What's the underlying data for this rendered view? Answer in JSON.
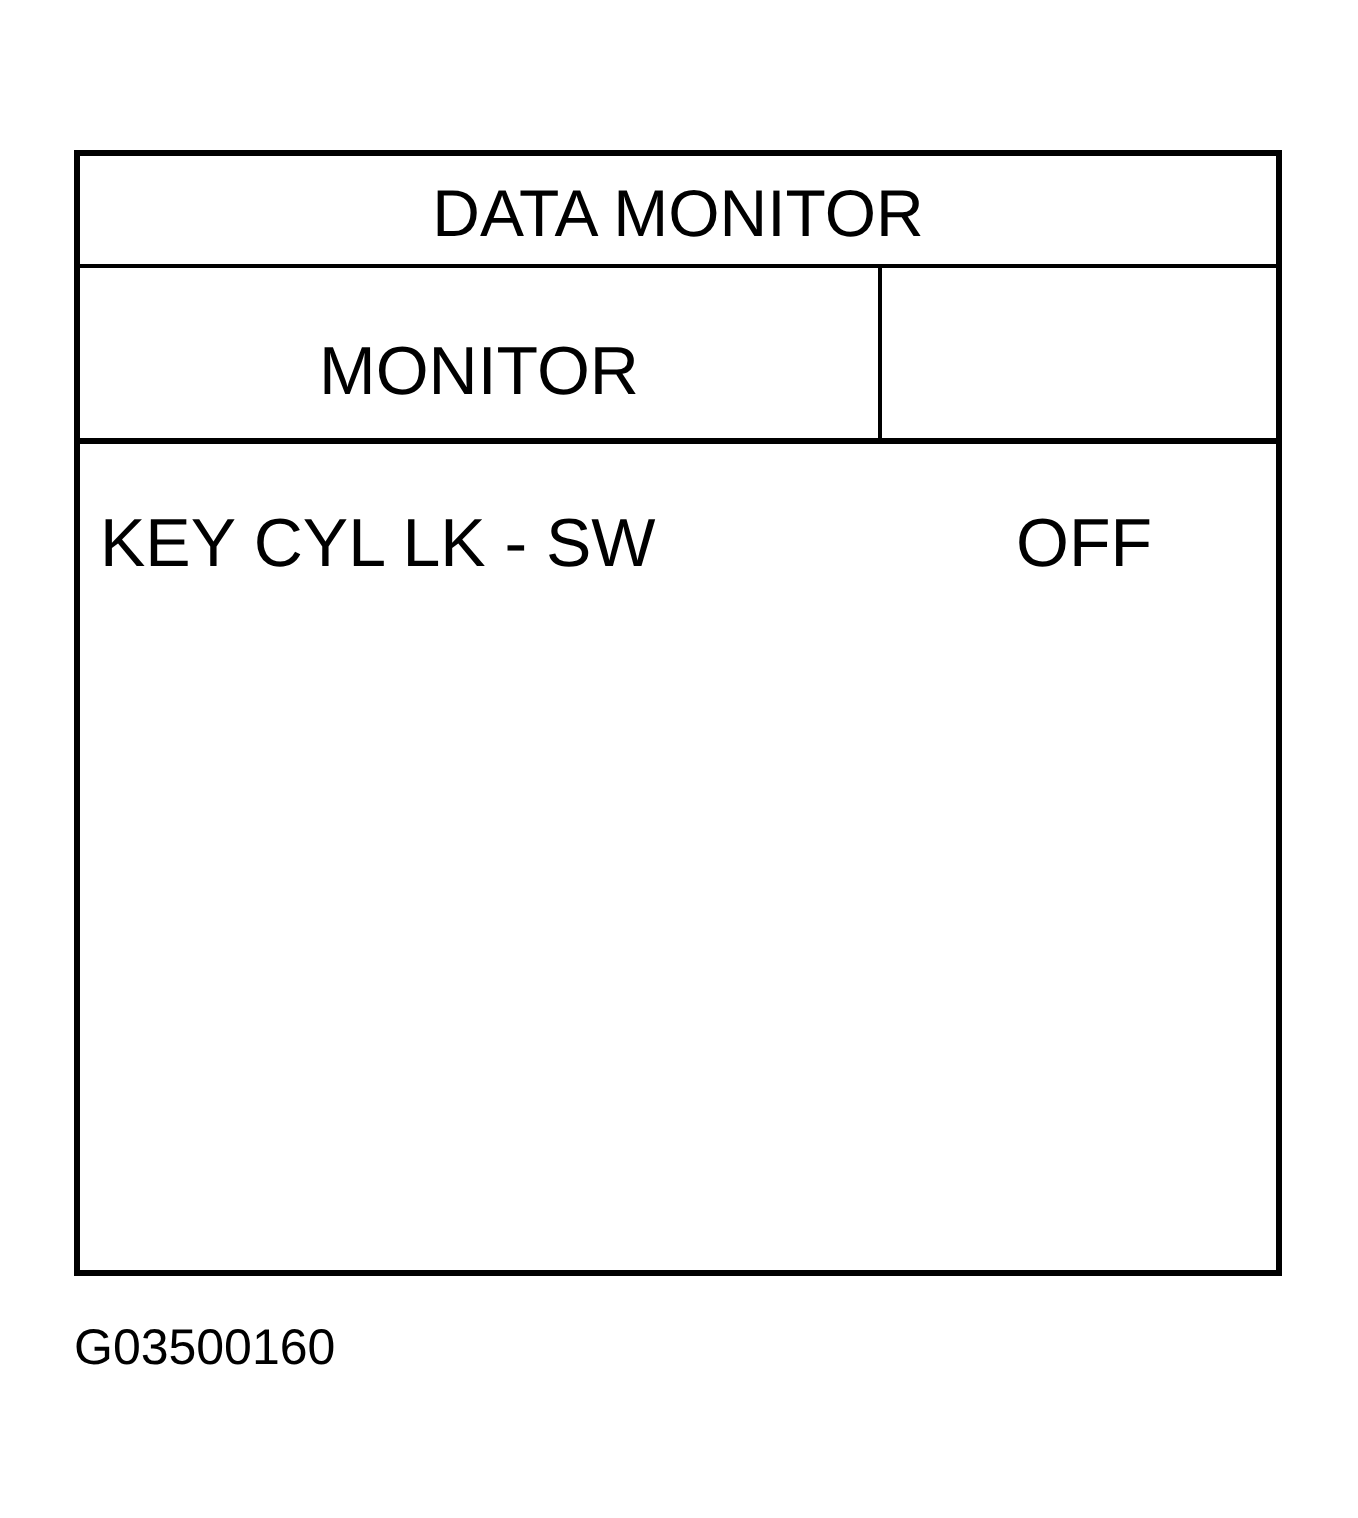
{
  "data_monitor": {
    "title": "DATA MONITOR",
    "header": {
      "column_1": "MONITOR"
    },
    "rows": [
      {
        "item": "KEY CYL LK - SW",
        "value": "OFF"
      }
    ]
  },
  "figure_code": "G03500160"
}
